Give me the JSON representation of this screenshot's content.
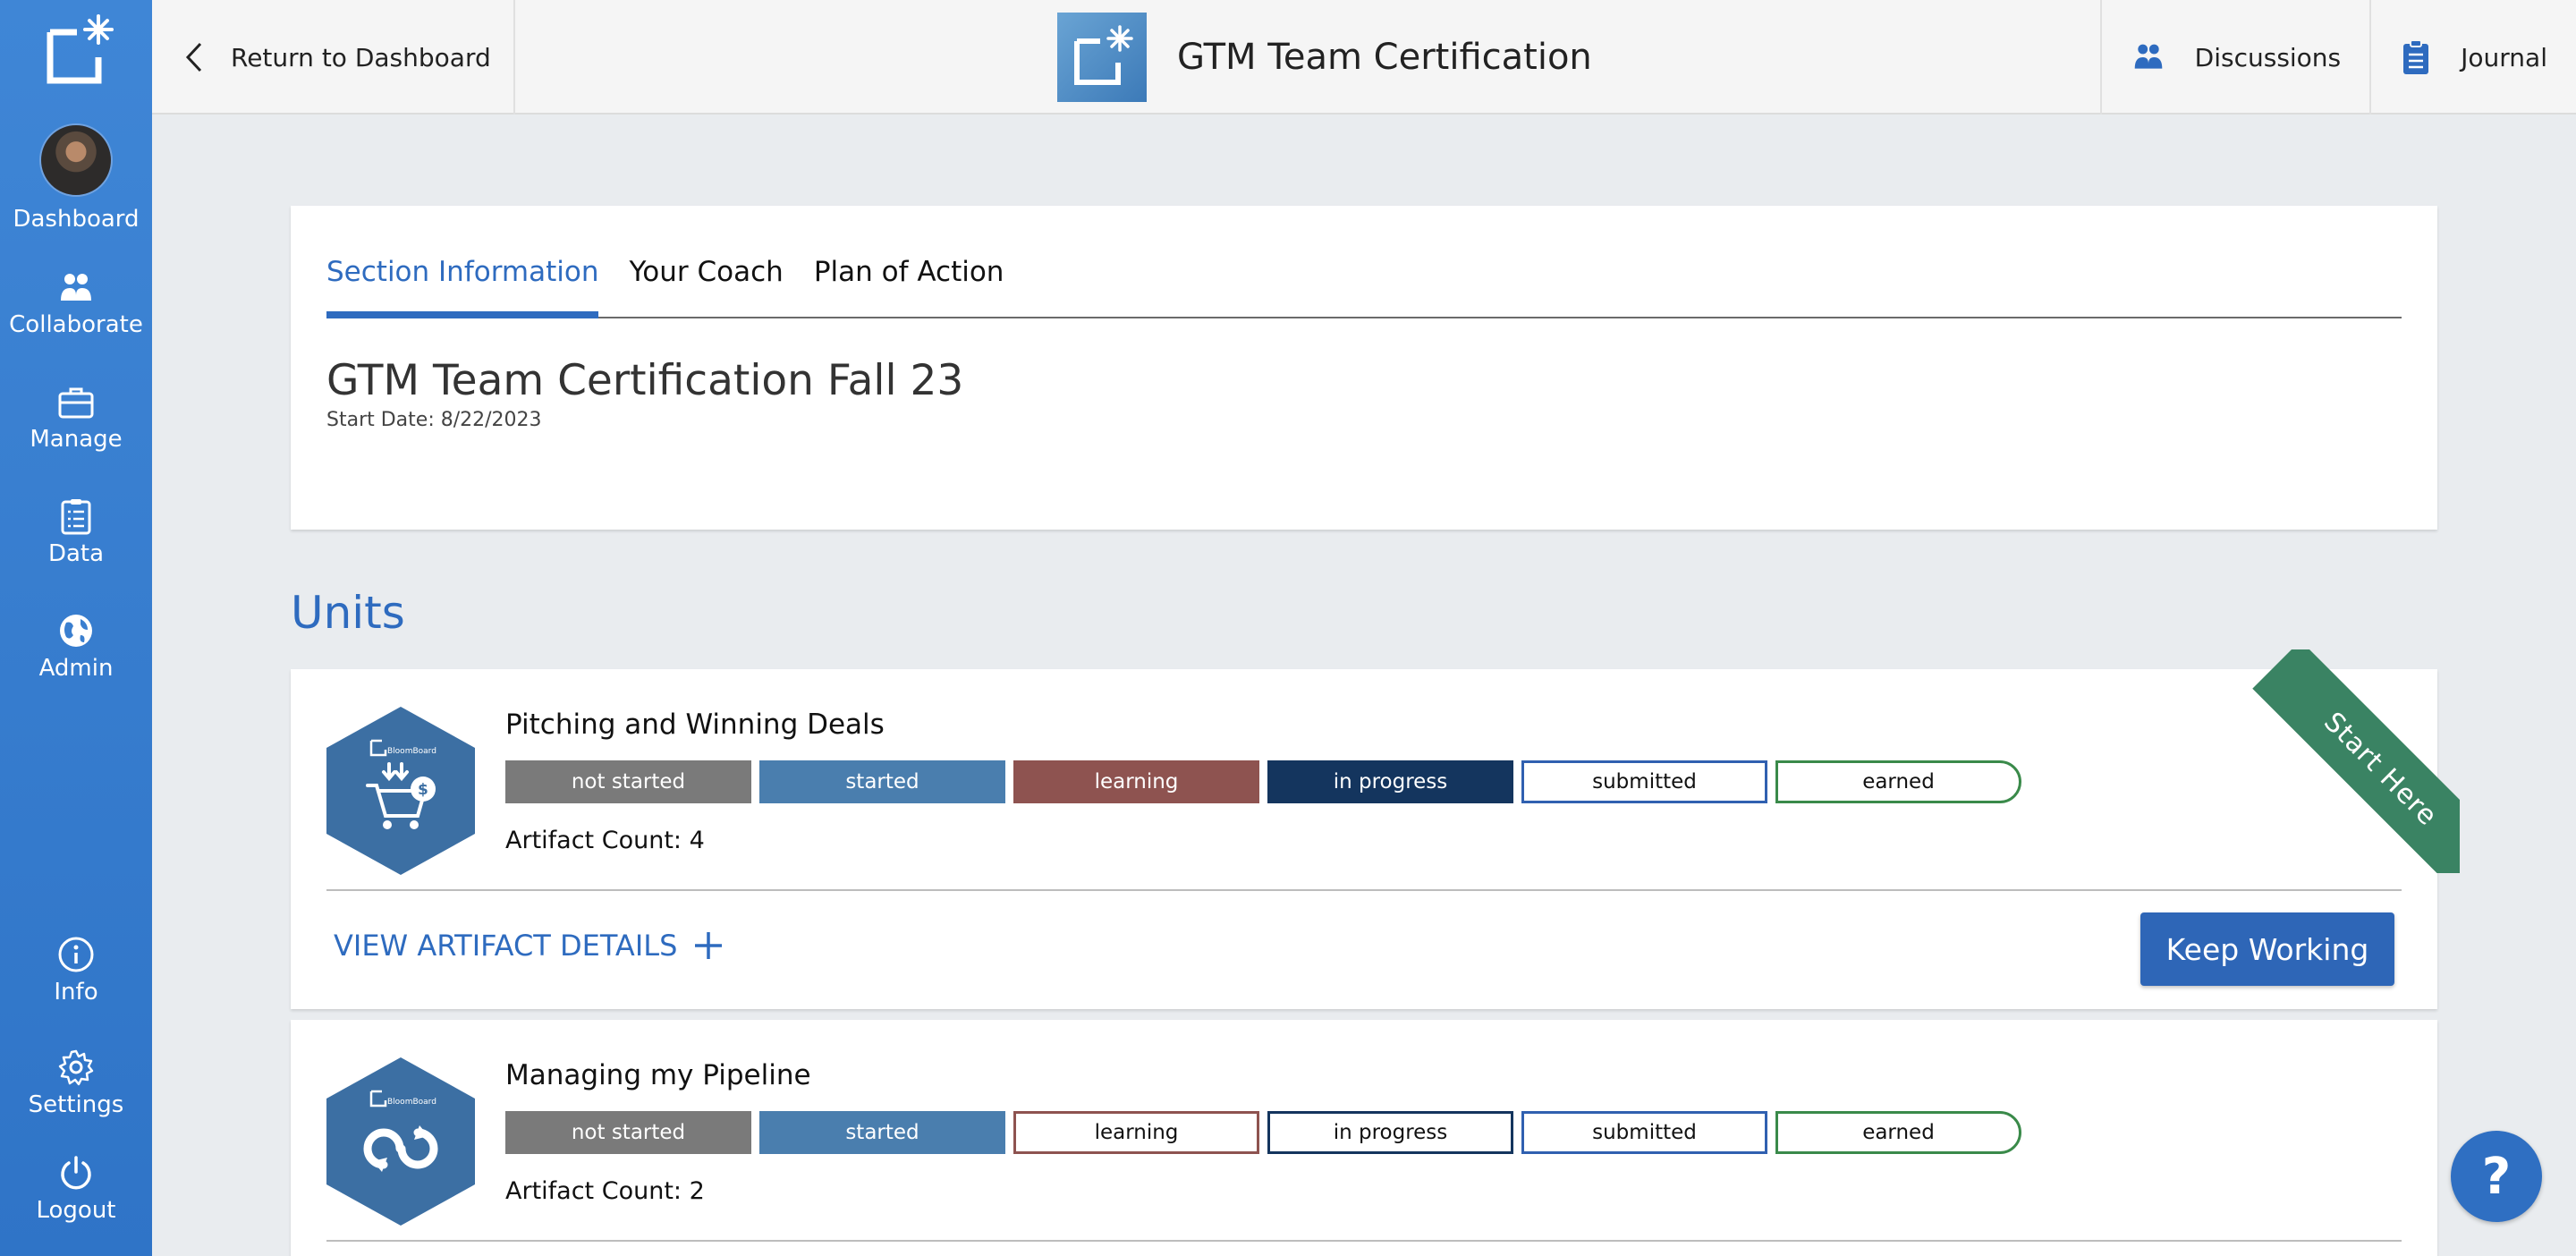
{
  "sidebar": {
    "items": [
      {
        "label": "Dashboard",
        "icon": "avatar"
      },
      {
        "label": "Collaborate",
        "icon": "users-icon"
      },
      {
        "label": "Manage",
        "icon": "briefcase-icon"
      },
      {
        "label": "Data",
        "icon": "clipboard-list-icon"
      },
      {
        "label": "Admin",
        "icon": "globe-icon"
      },
      {
        "label": "Info",
        "icon": "info-icon"
      },
      {
        "label": "Settings",
        "icon": "gear-icon"
      },
      {
        "label": "Logout",
        "icon": "power-icon"
      }
    ]
  },
  "header": {
    "back_label": "Return to Dashboard",
    "title": "GTM Team Certification",
    "discussions_label": "Discussions",
    "journal_label": "Journal"
  },
  "section": {
    "tabs": [
      "Section Information",
      "Your Coach",
      "Plan of Action"
    ],
    "active_tab": "Section Information",
    "title": "GTM Team Certification Fall 23",
    "start_date": "Start Date: 8/22/2023"
  },
  "units_heading": "Units",
  "units": [
    {
      "title": "Pitching and Winning Deals",
      "badge_text": "BloomBoard",
      "statuses": [
        "not started",
        "started",
        "learning",
        "in progress",
        "submitted",
        "earned"
      ],
      "artifact_count": "Artifact Count: 4",
      "view_details": "VIEW ARTIFACT DETAILS",
      "action": "Keep Working",
      "ribbon": "Start Here"
    },
    {
      "title": "Managing my Pipeline",
      "badge_text": "BloomBoard",
      "statuses": [
        "not started",
        "started",
        "learning",
        "in progress",
        "submitted",
        "earned"
      ],
      "artifact_count": "Artifact Count: 2"
    }
  ],
  "help_label": "?",
  "colors": {
    "accent": "#2e6bbf",
    "sidebar": "#3a7fd0",
    "not_started": "#7a7a7a",
    "started": "#4a7eae",
    "learning": "#8e5350",
    "in_progress": "#14355e",
    "submitted": "#3060b0",
    "earned": "#3a8a4a",
    "ribbon": "#3a8363"
  }
}
